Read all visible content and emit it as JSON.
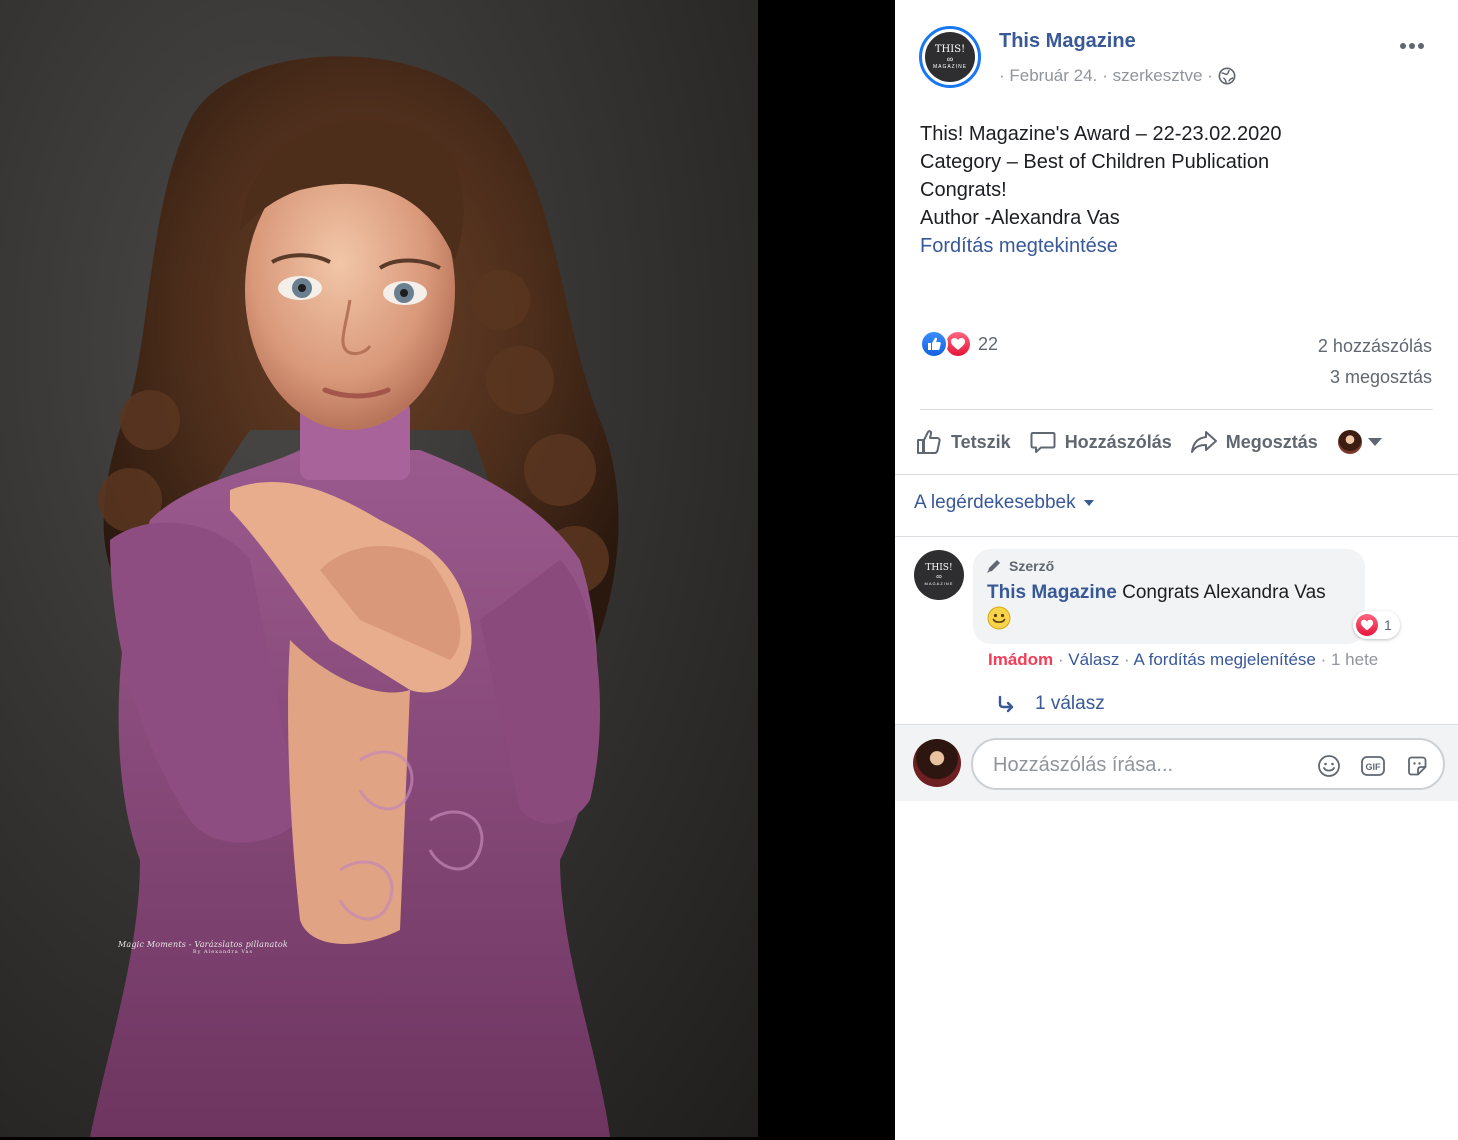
{
  "photo": {
    "watermark_line1": "Magic Moments - Varázslatos pillanatok",
    "watermark_line2": "By Alexandra Vas"
  },
  "post": {
    "page_name": "This Magazine",
    "page_logo": {
      "line1": "THIS!",
      "line2": "∞",
      "line3": "MAGAZINE"
    },
    "date": "· Február 24.",
    "edited": "· szerkesztve ·",
    "privacy_icon": "globe-icon",
    "text_lines": [
      "This! Magazine's Award – 22-23.02.2020",
      "Category – Best of Children Publication",
      "Congrats!",
      "Author -Alexandra Vas"
    ],
    "translate_link": "Fordítás megtekintése"
  },
  "stats": {
    "reaction_count": "22",
    "comments": "2 hozzászólás",
    "shares": "3 megosztás"
  },
  "actions": {
    "like": "Tetszik",
    "comment": "Hozzászólás",
    "share": "Megosztás"
  },
  "comments_section": {
    "sort_label": "A legérdekesebbek",
    "comment": {
      "badge": "Szerző",
      "author": "This Magazine",
      "text": "Congrats Alexandra Vas",
      "reaction_count": "1",
      "love_label": "Imádom",
      "sep1": " · ",
      "reply_label": "Válasz",
      "sep2": " · ",
      "translation_label": "A fordítás megjelenítése",
      "time": " · 1 hete"
    },
    "replies_label": "1 válasz"
  },
  "composer": {
    "placeholder": "Hozzászólás írása..."
  },
  "colors": {
    "link_blue": "#385898",
    "like_blue": "#1877f2",
    "love_red": "#f33e58"
  }
}
